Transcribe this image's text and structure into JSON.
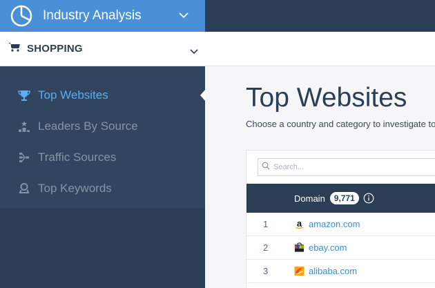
{
  "app": {
    "title": "Industry Analysis"
  },
  "category": {
    "label": "SHOPPING"
  },
  "sidebar": {
    "items": [
      {
        "label": "Top Websites",
        "icon": "trophy-icon",
        "active": true
      },
      {
        "label": "Leaders By Source",
        "icon": "podium-icon",
        "active": false
      },
      {
        "label": "Traffic Sources",
        "icon": "flow-icon",
        "active": false
      },
      {
        "label": "Top Keywords",
        "icon": "keyword-icon",
        "active": false
      }
    ]
  },
  "main": {
    "title": "Top Websites",
    "subtitle": "Choose a country and category to investigate top websites",
    "search_placeholder": "Search...",
    "table": {
      "domain_header": "Domain",
      "domain_count": "9,771",
      "rows": [
        {
          "rank": "1",
          "domain": "amazon.com",
          "icon": "amazon-favicon"
        },
        {
          "rank": "2",
          "domain": "ebay.com",
          "icon": "ebay-favicon"
        },
        {
          "rank": "3",
          "domain": "alibaba.com",
          "icon": "alibaba-favicon"
        }
      ]
    }
  },
  "colors": {
    "navy": "#2c3e56",
    "accent_blue": "#4a90d9",
    "active_link": "#5aaef2",
    "link": "#3b8fd6"
  }
}
